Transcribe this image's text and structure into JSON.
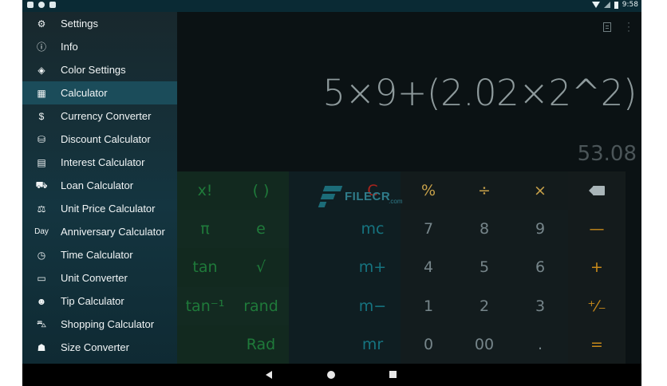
{
  "status_bar": {
    "time": "9:58"
  },
  "drawer": {
    "items": [
      {
        "label": "Settings",
        "icon": "gear-icon",
        "glyph": "⚙"
      },
      {
        "label": "Info",
        "icon": "info-icon",
        "glyph": "ⓘ"
      },
      {
        "label": "Color Settings",
        "icon": "paint-bucket-icon",
        "glyph": "◈"
      },
      {
        "label": "Calculator",
        "icon": "calculator-icon",
        "glyph": "▦"
      },
      {
        "label": "Currency Converter",
        "icon": "dollar-icon",
        "glyph": "$"
      },
      {
        "label": "Discount Calculator",
        "icon": "shopping-bag-icon",
        "glyph": "⛁"
      },
      {
        "label": "Interest Calculator",
        "icon": "interest-icon",
        "glyph": "▤"
      },
      {
        "label": "Loan Calculator",
        "icon": "car-icon",
        "glyph": "⛟"
      },
      {
        "label": "Unit Price Calculator",
        "icon": "scale-icon",
        "glyph": "⚖"
      },
      {
        "label": "Anniversary Calculator",
        "icon": "day-icon",
        "glyph": "Day"
      },
      {
        "label": "Time Calculator",
        "icon": "clock-icon",
        "glyph": "◷"
      },
      {
        "label": "Unit Converter",
        "icon": "ruler-icon",
        "glyph": "▭"
      },
      {
        "label": "Tip Calculator",
        "icon": "tip-icon",
        "glyph": "☻"
      },
      {
        "label": "Shopping Calculator",
        "icon": "cart-icon",
        "glyph": "⛍"
      },
      {
        "label": "Size Converter",
        "icon": "shirt-icon",
        "glyph": "☗"
      }
    ],
    "active_index": 3
  },
  "display": {
    "expression": "5×9+(2.02×2^2)",
    "result": "53.08"
  },
  "keypad": {
    "rows": [
      [
        "x!",
        "( )",
        "",
        "C",
        "%",
        "÷",
        "×",
        "⌫"
      ],
      [
        "π",
        "e",
        "",
        "mc",
        "7",
        "8",
        "9",
        "—"
      ],
      [
        "tan",
        "√",
        "",
        "m+",
        "4",
        "5",
        "6",
        "+"
      ],
      [
        "tan⁻¹",
        "rand",
        "",
        "m−",
        "1",
        "2",
        "3",
        "⁺⁄₋"
      ],
      [
        "",
        "Rad",
        "",
        "mr",
        "0",
        "00",
        ".",
        "="
      ]
    ]
  },
  "watermark": {
    "text": "FILECR",
    "sub": ".com"
  },
  "colors": {
    "drawer_bg": "#143540",
    "drawer_active": "#1b4c5a",
    "scientific_key": "#1f7a3a",
    "memory_key": "#167480",
    "operator_key": "#c88a1a",
    "clear_key": "#a8241d"
  }
}
